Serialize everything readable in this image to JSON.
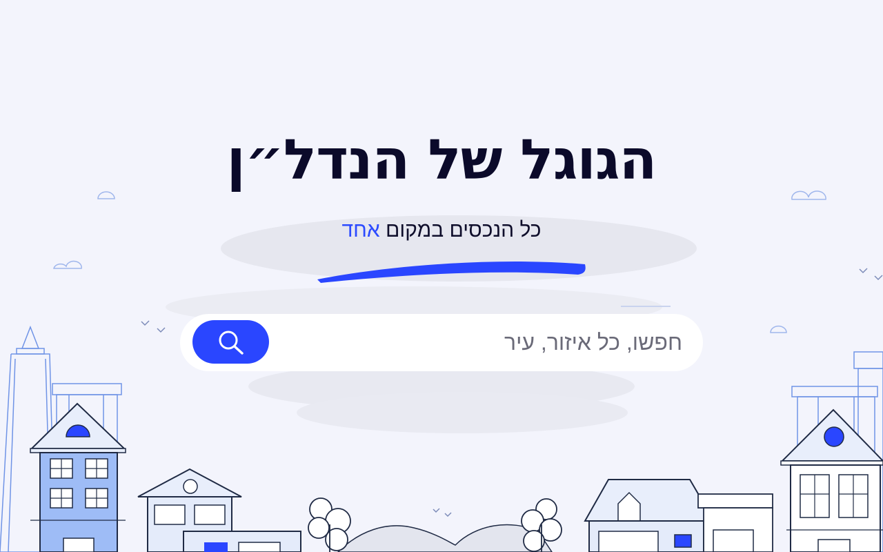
{
  "hero": {
    "title": "הגוגל של הנדל״ן",
    "subtitle_main": "כל הנכסים במקום",
    "subtitle_accent": "אחד"
  },
  "search": {
    "placeholder": "חפשו, כל איזור, עיר",
    "value": "",
    "button_icon": "search-icon"
  },
  "colors": {
    "background": "#f3f4fc",
    "accent": "#2a46ff",
    "title": "#0b0a2a"
  }
}
